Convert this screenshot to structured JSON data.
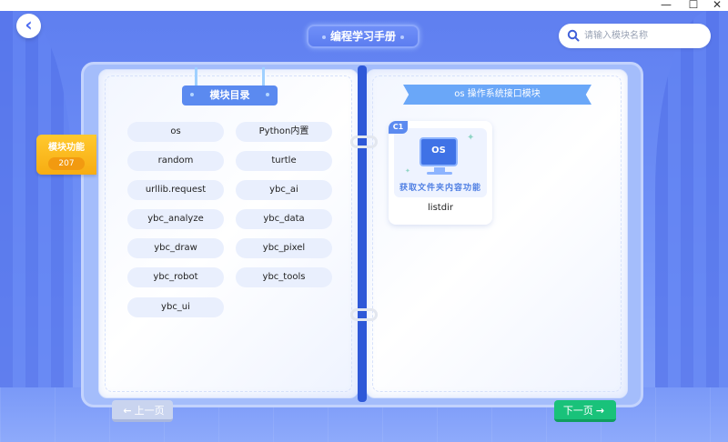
{
  "window": {
    "minimize_glyph": "—",
    "maximize_glyph": "☐",
    "close_glyph": "✕"
  },
  "header": {
    "back_glyph": "‹",
    "title": "编程学习手册",
    "search_placeholder": "请输入模块名称",
    "search_value": ""
  },
  "side_tab": {
    "label": "模块功能",
    "count": "207"
  },
  "catalog": {
    "title": "模块目录",
    "modules": [
      "os",
      "Python内置",
      "random",
      "turtle",
      "urllib.request",
      "ybc_ai",
      "ybc_analyze",
      "ybc_data",
      "ybc_draw",
      "ybc_pixel",
      "ybc_robot",
      "ybc_tools",
      "ybc_ui"
    ]
  },
  "module_panel": {
    "title": "os 操作系统接口模块",
    "cards": [
      {
        "badge": "C1",
        "icon_text": "OS",
        "caption": "获取文件夹内容功能",
        "name": "listdir"
      }
    ]
  },
  "footer": {
    "prev_label": "上一页",
    "prev_arrow": "←",
    "next_label": "下一页",
    "next_arrow": "→"
  },
  "icons": {
    "back": "chevron-left-icon",
    "search": "search-icon",
    "computer": "monitor-icon"
  },
  "colors": {
    "background": "#6b8cf5",
    "accent_blue": "#5b8af0",
    "side_tab": "#f7ac12",
    "next_button": "#19c27a",
    "prev_button": "#c9d4ef"
  }
}
